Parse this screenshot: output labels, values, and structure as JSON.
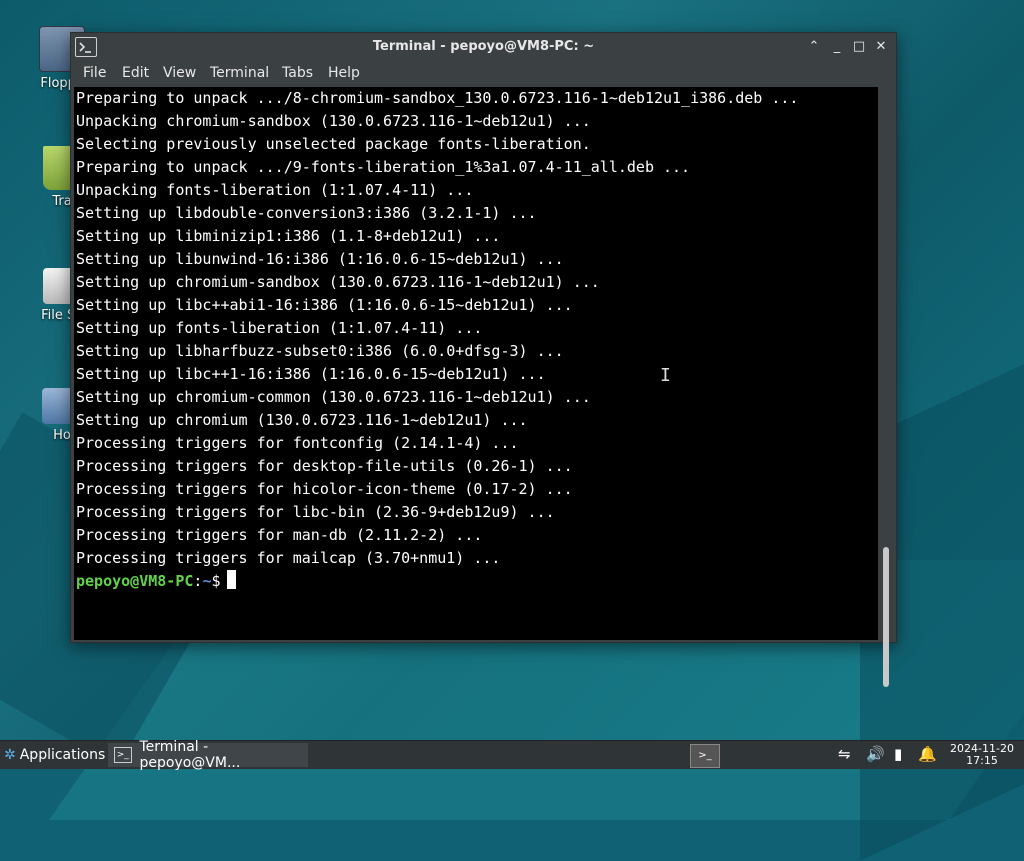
{
  "desktop": {
    "icons": [
      {
        "label": "Floppy",
        "icon": "floppy-icon"
      },
      {
        "label": "Tra",
        "icon": "trash-icon"
      },
      {
        "label": "File Sy",
        "icon": "filesystem-icon"
      },
      {
        "label": "Ho",
        "icon": "home-folder-icon"
      }
    ]
  },
  "window": {
    "title": "Terminal - pepoyo@VM8-PC: ~",
    "buttons": {
      "roll_up": "⌃",
      "minimize": "_",
      "maximize": "□",
      "close": "✕"
    },
    "menu": [
      "File",
      "Edit",
      "View",
      "Terminal",
      "Tabs",
      "Help"
    ]
  },
  "terminal": {
    "lines": [
      "Preparing to unpack .../8-chromium-sandbox_130.0.6723.116-1~deb12u1_i386.deb ...",
      "Unpacking chromium-sandbox (130.0.6723.116-1~deb12u1) ...",
      "Selecting previously unselected package fonts-liberation.",
      "Preparing to unpack .../9-fonts-liberation_1%3a1.07.4-11_all.deb ...",
      "Unpacking fonts-liberation (1:1.07.4-11) ...",
      "Setting up libdouble-conversion3:i386 (3.2.1-1) ...",
      "Setting up libminizip1:i386 (1.1-8+deb12u1) ...",
      "Setting up libunwind-16:i386 (1:16.0.6-15~deb12u1) ...",
      "Setting up chromium-sandbox (130.0.6723.116-1~deb12u1) ...",
      "Setting up libc++abi1-16:i386 (1:16.0.6-15~deb12u1) ...",
      "Setting up fonts-liberation (1:1.07.4-11) ...",
      "Setting up libharfbuzz-subset0:i386 (6.0.0+dfsg-3) ...",
      "Setting up libc++1-16:i386 (1:16.0.6-15~deb12u1) ...",
      "Setting up chromium-common (130.0.6723.116-1~deb12u1) ...",
      "Setting up chromium (130.0.6723.116-1~deb12u1) ...",
      "Processing triggers for fontconfig (2.14.1-4) ...",
      "Processing triggers for desktop-file-utils (0.26-1) ...",
      "Processing triggers for hicolor-icon-theme (0.17-2) ...",
      "Processing triggers for libc-bin (2.36-9+deb12u9) ...",
      "Processing triggers for man-db (2.11.2-2) ...",
      "Processing triggers for mailcap (3.70+nmu1) ..."
    ],
    "prompt": {
      "user_host": "pepoyo@VM8-PC",
      "sep": ":",
      "path": "~",
      "symbol": "$"
    },
    "colors": {
      "background": "#000000",
      "text": "#ffffff",
      "prompt_user": "#63d24a",
      "prompt_path": "#5b8fd8"
    }
  },
  "taskbar": {
    "applications_label": "Applications",
    "task_label": "Terminal - pepoyo@VM...",
    "tray_icons": [
      "network-icon",
      "volume-icon",
      "battery-icon",
      "notification-bell-icon"
    ],
    "clock": {
      "date": "2024-11-20",
      "time": "17:15"
    }
  }
}
